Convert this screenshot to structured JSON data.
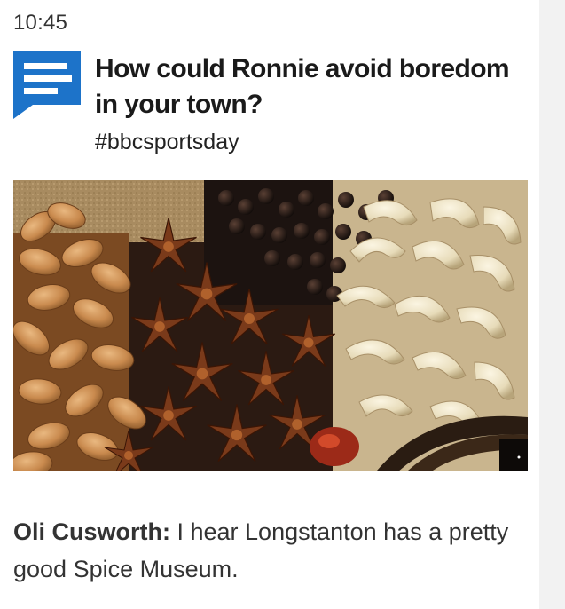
{
  "post": {
    "time": "10:45",
    "icon": "comment-bubble-icon",
    "accent_color": "#1d73c9",
    "question": "How could Ronnie avoid boredom in your town?",
    "hashtag": "#bbcsportsday",
    "image_subject": "spices-photo",
    "comment": {
      "author": "Oli Cusworth:",
      "text": " I hear Longstanton has a pretty good Spice Museum."
    }
  }
}
